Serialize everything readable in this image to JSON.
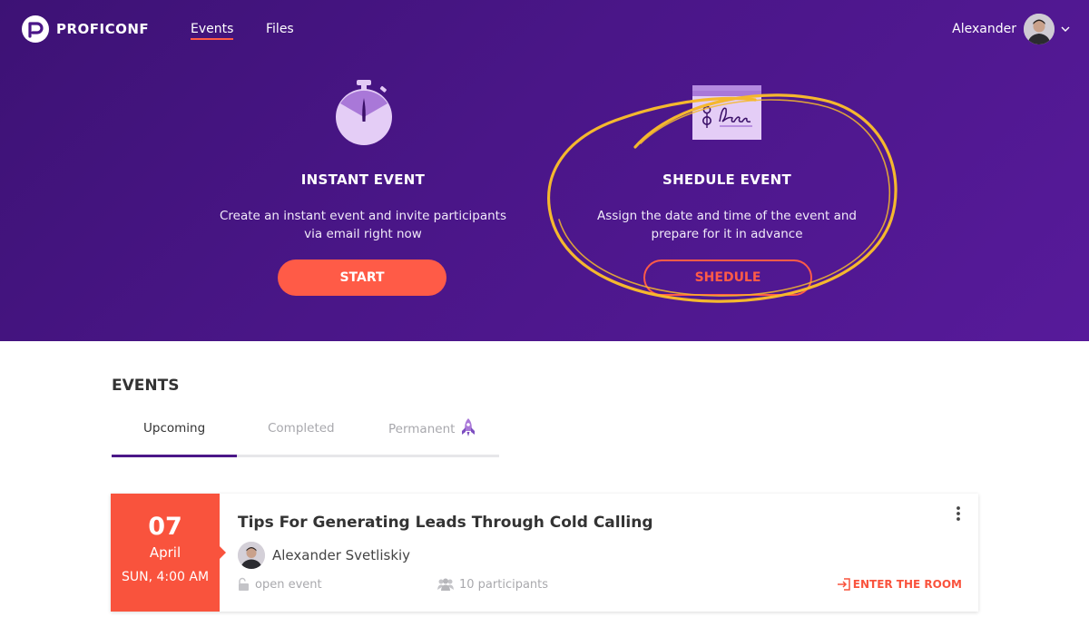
{
  "brand": {
    "name": "PROFICONF"
  },
  "nav": {
    "events_label": "Events",
    "files_label": "Files"
  },
  "user": {
    "name": "Alexander"
  },
  "instant": {
    "title": "INSTANT EVENT",
    "desc_line1": "Create an instant event and invite participants",
    "desc_line2": "via email right now",
    "button_label": "START"
  },
  "schedule": {
    "title": "SHEDULE EVENT",
    "desc_line1": "Assign the date and time of the event and",
    "desc_line2": "prepare for it in advance",
    "button_label": "SHEDULE"
  },
  "events": {
    "heading": "EVENTS",
    "tabs": [
      {
        "label": "Upcoming",
        "active": true
      },
      {
        "label": "Completed",
        "active": false
      },
      {
        "label": "Permanent",
        "active": false
      }
    ],
    "items": [
      {
        "day": "07",
        "month": "April",
        "time": "SUN, 4:00 AM",
        "title": "Tips For Generating Leads Through Cold Calling",
        "host": "Alexander Svetliskiy",
        "access": "open event",
        "participants": "10 participants",
        "action_label": "ENTER THE ROOM"
      }
    ]
  },
  "colors": {
    "hero_bg": "#4a1688",
    "accent": "#ff5b47",
    "highlight": "#f5b82e",
    "tab_active": "#4b1788"
  }
}
